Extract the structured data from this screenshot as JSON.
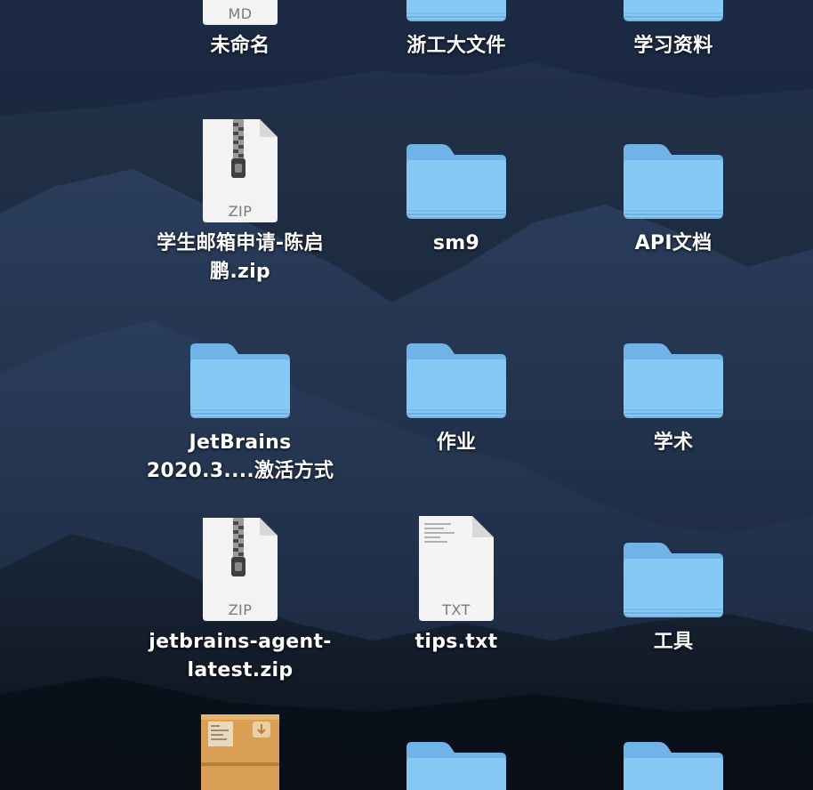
{
  "desktop": {
    "items": [
      {
        "label": "未命名",
        "type": "md-document",
        "tag": "MD"
      },
      {
        "label": "浙工大文件",
        "type": "folder"
      },
      {
        "label": "学习资料",
        "type": "folder"
      },
      {
        "label": "学生邮箱申请-陈启\n鹏.zip",
        "type": "zip-archive",
        "tag": "ZIP"
      },
      {
        "label": "sm9",
        "type": "folder"
      },
      {
        "label": "API文档",
        "type": "folder"
      },
      {
        "label": "JetBrains\n2020.3....激活方式",
        "type": "folder"
      },
      {
        "label": "作业",
        "type": "folder"
      },
      {
        "label": "学术",
        "type": "folder"
      },
      {
        "label": "jetbrains-agent-\nlatest.zip",
        "type": "zip-archive",
        "tag": "ZIP"
      },
      {
        "label": "tips.txt",
        "type": "txt-document",
        "tag": "TXT"
      },
      {
        "label": "工具",
        "type": "folder"
      },
      {
        "label": "",
        "type": "installer-package"
      },
      {
        "label": "",
        "type": "folder"
      },
      {
        "label": "",
        "type": "folder"
      }
    ]
  },
  "colors": {
    "folder_body": "#86C9F4",
    "folder_tab": "#6FB3E8",
    "label_text": "#FFFFFF",
    "wallpaper": "#0E1525"
  }
}
